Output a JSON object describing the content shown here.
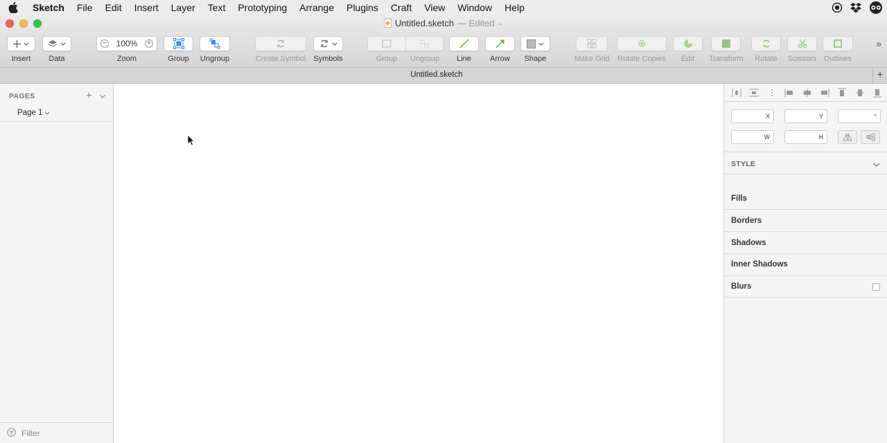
{
  "menubar": {
    "app_name": "Sketch",
    "items": [
      "File",
      "Edit",
      "Insert",
      "Layer",
      "Text",
      "Prototyping",
      "Arrange",
      "Plugins",
      "Craft",
      "View",
      "Window",
      "Help"
    ]
  },
  "window": {
    "title": "Untitled.sketch",
    "edited": "— Edited"
  },
  "toolbar": {
    "insert": "Insert",
    "data": "Data",
    "zoom": "Zoom",
    "zoom_value": "100%",
    "group": "Group",
    "ungroup": "Ungroup",
    "create_symbol": "Create Symbol",
    "symbols": "Symbols",
    "group2": "Group",
    "ungroup2": "Ungroup",
    "line": "Line",
    "arrow": "Arrow",
    "shape": "Shape",
    "make_grid": "Make Grid",
    "rotate_copies": "Rotate Copies",
    "edit": "Edit",
    "transform": "Transform",
    "rotate": "Rotate",
    "scissors": "Scissors",
    "outlines": "Outlines"
  },
  "tabbar": {
    "title": "Untitled.sketch"
  },
  "pages": {
    "header": "PAGES",
    "items": [
      "Page 1"
    ],
    "filter_placeholder": "Filter"
  },
  "inspector": {
    "x_label": "X",
    "y_label": "Y",
    "rotation_label": "°",
    "w_label": "W",
    "h_label": "H",
    "style_header": "STYLE",
    "sections": [
      "Fills",
      "Borders",
      "Shadows",
      "Inner Shadows",
      "Blurs"
    ]
  },
  "colors": {
    "accent_green": "#5cb335",
    "accent_blue": "#2f8ef2",
    "traffic_red": "#fc605b",
    "traffic_yellow": "#fdbc40",
    "traffic_green": "#34c84a"
  }
}
